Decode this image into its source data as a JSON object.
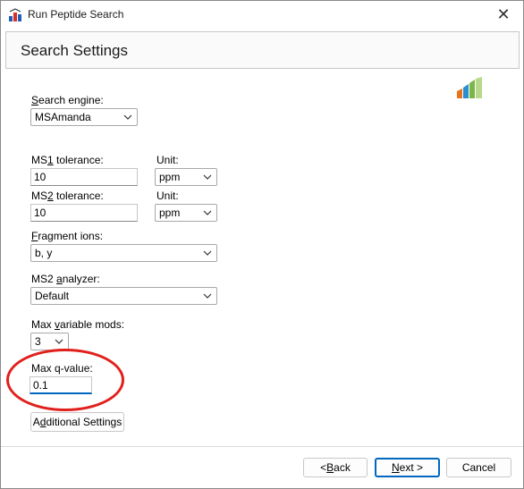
{
  "window": {
    "title": "Run Peptide Search",
    "close_glyph": "✕"
  },
  "header": {
    "title": "Search Settings"
  },
  "form": {
    "search_engine": {
      "label_prefix": "",
      "label_mnemonic": "S",
      "label_rest": "earch engine:",
      "value": "MSAmanda"
    },
    "ms1_tolerance": {
      "label_prefix": "MS",
      "label_mnemonic": "1",
      "label_rest": " tolerance:",
      "value": "10"
    },
    "ms1_unit": {
      "label": "Unit:",
      "value": "ppm"
    },
    "ms2_tolerance": {
      "label_prefix": "MS",
      "label_mnemonic": "2",
      "label_rest": " tolerance:",
      "value": "10"
    },
    "ms2_unit": {
      "label": "Unit:",
      "value": "ppm"
    },
    "fragment_ions": {
      "label_prefix": "",
      "label_mnemonic": "F",
      "label_rest": "ragment ions:",
      "value": "b, y"
    },
    "ms2_analyzer": {
      "label_prefix": "MS2 ",
      "label_mnemonic": "a",
      "label_rest": "nalyzer:",
      "value": "Default"
    },
    "max_variable_mods": {
      "label_prefix": "Max ",
      "label_mnemonic": "v",
      "label_rest": "ariable mods:",
      "value": "3"
    },
    "max_q_value": {
      "label": "Max q-value:",
      "value": "0.1"
    },
    "additional_settings": {
      "label_prefix": "A",
      "label_mnemonic": "d",
      "label_rest": "ditional Settings"
    }
  },
  "footer": {
    "back": {
      "label_prefix": "< ",
      "label_mnemonic": "B",
      "label_rest": "ack"
    },
    "next": {
      "label_prefix": "",
      "label_mnemonic": "N",
      "label_rest": "ext >"
    },
    "cancel": {
      "label": "Cancel"
    }
  },
  "colors": {
    "accent": "#0067c0",
    "annotation": "#e0201c"
  }
}
